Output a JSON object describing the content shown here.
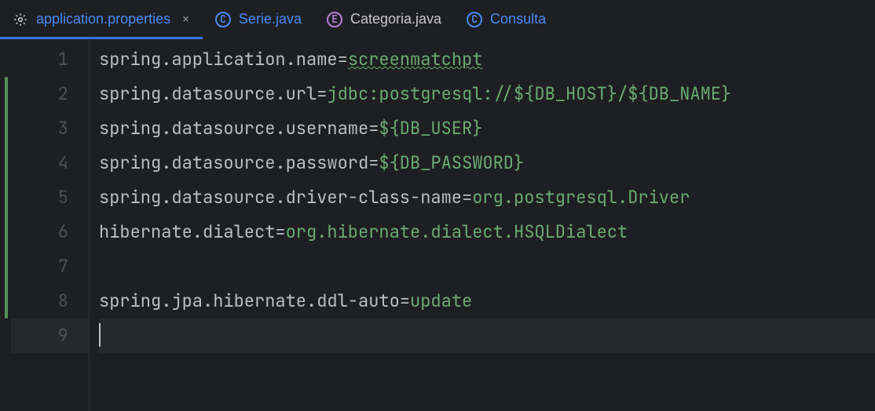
{
  "tabs": [
    {
      "label": "application.properties",
      "iconType": "gear",
      "active": true,
      "closable": true
    },
    {
      "label": "Serie.java",
      "iconType": "class-c"
    },
    {
      "label": "Categoria.java",
      "iconType": "enum-e"
    },
    {
      "label": "Consulta",
      "iconType": "class-c",
      "truncated": true
    }
  ],
  "lines": [
    {
      "num": "1",
      "segments": [
        {
          "t": "spring.application.name=",
          "c": "prop-key"
        },
        {
          "t": "screenmatchpt",
          "c": "prop-value-underline"
        }
      ]
    },
    {
      "num": "2",
      "segments": [
        {
          "t": "spring.datasource.url=",
          "c": "prop-key"
        },
        {
          "t": "jdbc:postgresql://${DB_HOST}/${DB_NAME}",
          "c": "prop-value"
        }
      ]
    },
    {
      "num": "3",
      "segments": [
        {
          "t": "spring.datasource.username=",
          "c": "prop-key"
        },
        {
          "t": "${DB_USER}",
          "c": "prop-value"
        }
      ]
    },
    {
      "num": "4",
      "segments": [
        {
          "t": "spring.datasource.password=",
          "c": "prop-key"
        },
        {
          "t": "${DB_PASSWORD}",
          "c": "prop-value"
        }
      ]
    },
    {
      "num": "5",
      "segments": [
        {
          "t": "spring.datasource.driver-class-name=",
          "c": "prop-key"
        },
        {
          "t": "org.postgresql.Driver",
          "c": "prop-value"
        }
      ]
    },
    {
      "num": "6",
      "segments": [
        {
          "t": "hibernate.dialect=",
          "c": "prop-key"
        },
        {
          "t": "org.hibernate.dialect.HSQLDialect",
          "c": "prop-value"
        }
      ]
    },
    {
      "num": "7",
      "segments": []
    },
    {
      "num": "8",
      "segments": [
        {
          "t": "spring.jpa.hibernate.ddl-auto=",
          "c": "prop-key"
        },
        {
          "t": "update",
          "c": "prop-value"
        }
      ]
    },
    {
      "num": "9",
      "segments": [],
      "current": true,
      "cursor": true
    }
  ]
}
